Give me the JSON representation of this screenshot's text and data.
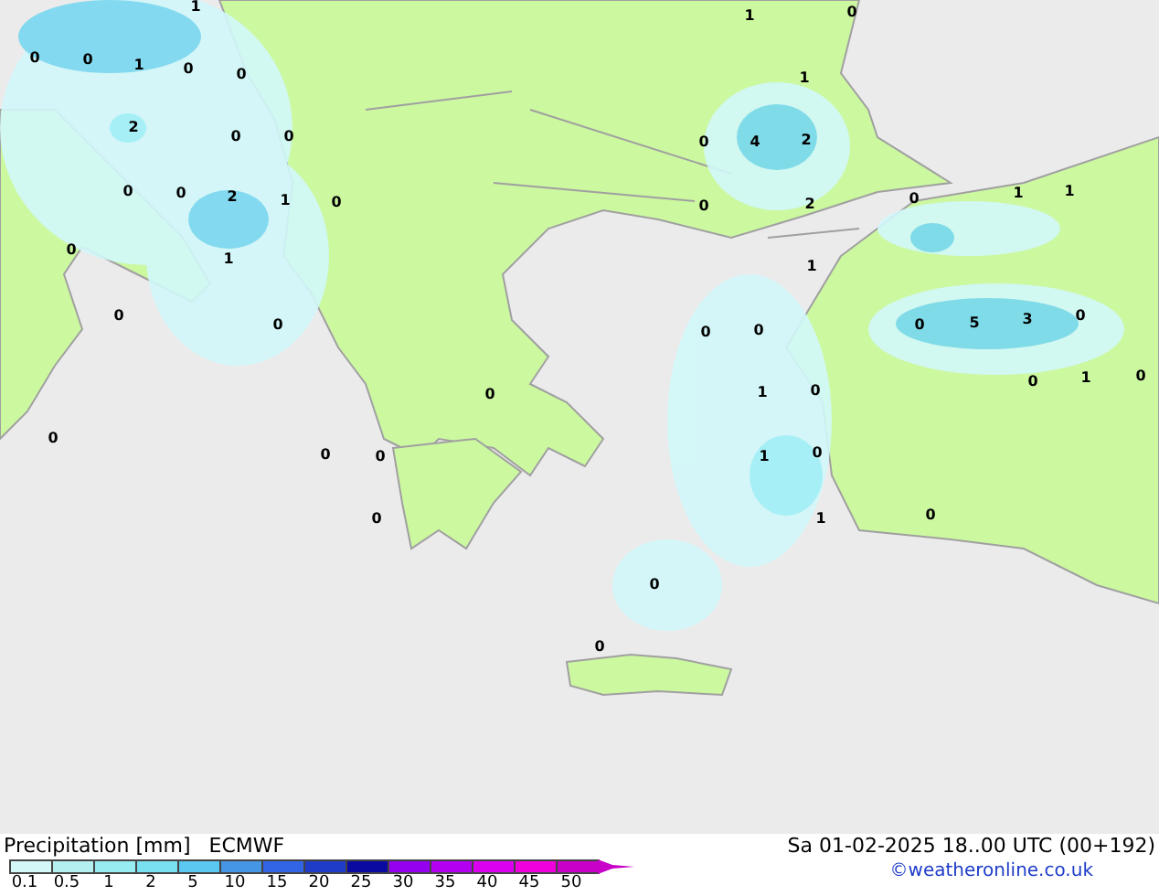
{
  "map": {
    "labels": [
      "1",
      "0",
      "0",
      "1",
      "0",
      "0",
      "2",
      "0",
      "0",
      "0",
      "0",
      "2",
      "1",
      "0",
      "0",
      "1",
      "0",
      "0",
      "0",
      "0",
      "0",
      "0",
      "0",
      "1",
      "0",
      "1",
      "0",
      "4",
      "2",
      "0",
      "2",
      "0",
      "1",
      "1",
      "1",
      "0",
      "0",
      "0",
      "5",
      "3",
      "0",
      "0",
      "1",
      "0",
      "1",
      "0",
      "1",
      "0",
      "1",
      "0",
      "0",
      "0"
    ]
  },
  "legend": {
    "title": "Precipitation [mm]",
    "model": "ECMWF",
    "date": "Sa 01-02-2025 18..00 UTC (00+192)",
    "credit": "©weatheronline.co.uk",
    "bins": [
      {
        "color": "#d4f8f8"
      },
      {
        "color": "#b4f0f0"
      },
      {
        "color": "#96ecf0"
      },
      {
        "color": "#78e0f0"
      },
      {
        "color": "#5ac8f0"
      },
      {
        "color": "#4696e6"
      },
      {
        "color": "#3264e6"
      },
      {
        "color": "#1e3cc8"
      },
      {
        "color": "#0a0aa0"
      },
      {
        "color": "#9600f0"
      },
      {
        "color": "#b400f0"
      },
      {
        "color": "#dc00f0"
      },
      {
        "color": "#f000dc"
      },
      {
        "color": "#c800c8"
      }
    ],
    "ticks": [
      "0.1",
      "0.5",
      "1",
      "2",
      "5",
      "10",
      "15",
      "20",
      "25",
      "30",
      "35",
      "40",
      "45",
      "50"
    ]
  }
}
